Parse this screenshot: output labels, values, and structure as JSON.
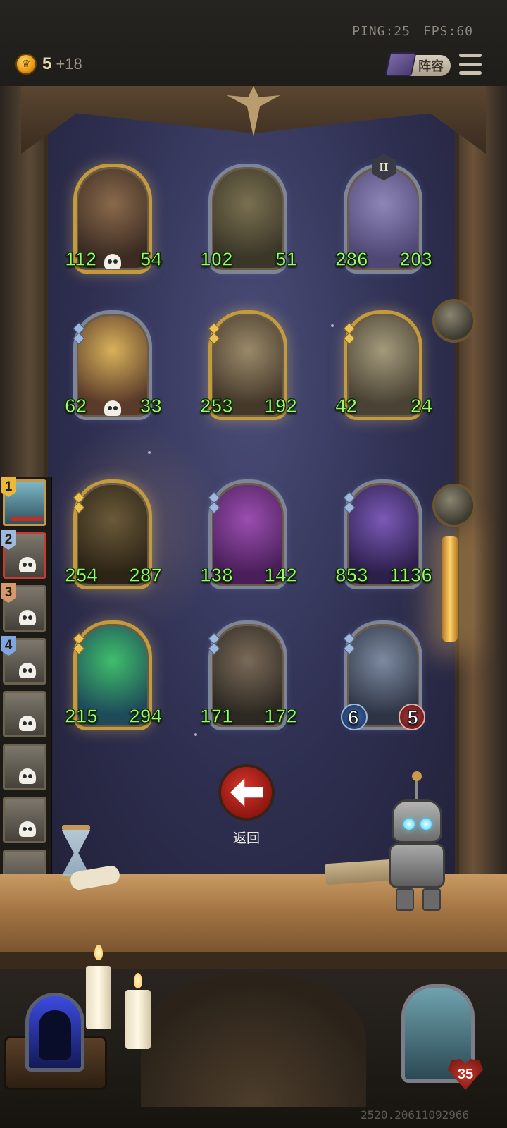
{
  "hud": {
    "ping": "PING:25",
    "fps": "FPS:60",
    "coins": "5",
    "coin_income": "+18",
    "lineup_label": "阵容"
  },
  "board": {
    "cards": [
      {
        "name": "gunner-lady",
        "atk": "112",
        "hp": "54",
        "frame": "gold",
        "skull": true,
        "badge": "",
        "colors": [
          "#8a6a4c",
          "#3b2b22"
        ]
      },
      {
        "name": "hunter",
        "atk": "102",
        "hp": "51",
        "frame": "silver",
        "skull": false,
        "badge": "",
        "colors": [
          "#7a7050",
          "#3a3628"
        ]
      },
      {
        "name": "knight-squire",
        "atk": "286",
        "hp": "203",
        "frame": "silver",
        "skull": false,
        "badge": "II",
        "colors": [
          "#8e86b8",
          "#4f4875"
        ]
      },
      {
        "name": "horned-goblin",
        "atk": "62",
        "hp": "33",
        "frame": "silver",
        "skull": true,
        "badge": "",
        "colors": [
          "#d8b25a",
          "#5a3a2a"
        ]
      },
      {
        "name": "armored-heroine",
        "atk": "253",
        "hp": "192",
        "frame": "gold",
        "skull": false,
        "badge": "",
        "colors": [
          "#9a8a6a",
          "#44382a"
        ]
      },
      {
        "name": "rose-knight",
        "atk": "42",
        "hp": "24",
        "frame": "gold",
        "skull": false,
        "badge": "",
        "colors": [
          "#a39a7c",
          "#4a4234"
        ]
      },
      {
        "name": "pumpkin-beast",
        "atk": "254",
        "hp": "287",
        "frame": "gold",
        "skull": false,
        "badge": "",
        "colors": [
          "#6b5a3a",
          "#2c2416"
        ]
      },
      {
        "name": "cactus",
        "atk": "138",
        "hp": "142",
        "frame": "silver",
        "skull": false,
        "badge": "",
        "colors": [
          "#9a4fb0",
          "#4a1e5a"
        ]
      },
      {
        "name": "witch-queen",
        "atk": "853",
        "hp": "1136",
        "frame": "silver",
        "skull": false,
        "badge": "",
        "colors": [
          "#7a5ab8",
          "#2c1f4a"
        ]
      },
      {
        "name": "ghost-pair",
        "atk": "215",
        "hp": "294",
        "frame": "gold",
        "skull": false,
        "badge": "",
        "colors": [
          "#3fbf6a",
          "#1e4a5a"
        ]
      },
      {
        "name": "winged-demon",
        "atk": "171",
        "hp": "172",
        "frame": "silver",
        "skull": false,
        "badge": "",
        "colors": [
          "#7a6a58",
          "#2c2822"
        ]
      },
      {
        "name": "rose-knight-base",
        "atk": "6",
        "hp": "5",
        "frame": "silver",
        "skull": false,
        "badge": "",
        "colors": [
          "#7c8aa0",
          "#2e3444"
        ]
      }
    ]
  },
  "sidebar": {
    "players": [
      {
        "rank": "1",
        "rank_color": "#e9b93a"
      },
      {
        "rank": "2",
        "rank_color": "#9fb8de"
      },
      {
        "rank": "3",
        "rank_color": "#d49a6a"
      },
      {
        "rank": "4",
        "rank_color": "#7fa6e0"
      },
      {
        "rank": "",
        "rank_color": ""
      },
      {
        "rank": "",
        "rank_color": ""
      },
      {
        "rank": "",
        "rank_color": ""
      },
      {
        "rank": "",
        "rank_color": ""
      }
    ]
  },
  "actions": {
    "back_label": "返回"
  },
  "player": {
    "health": "35"
  },
  "footer": {
    "build_id": "2520.20611092966"
  }
}
